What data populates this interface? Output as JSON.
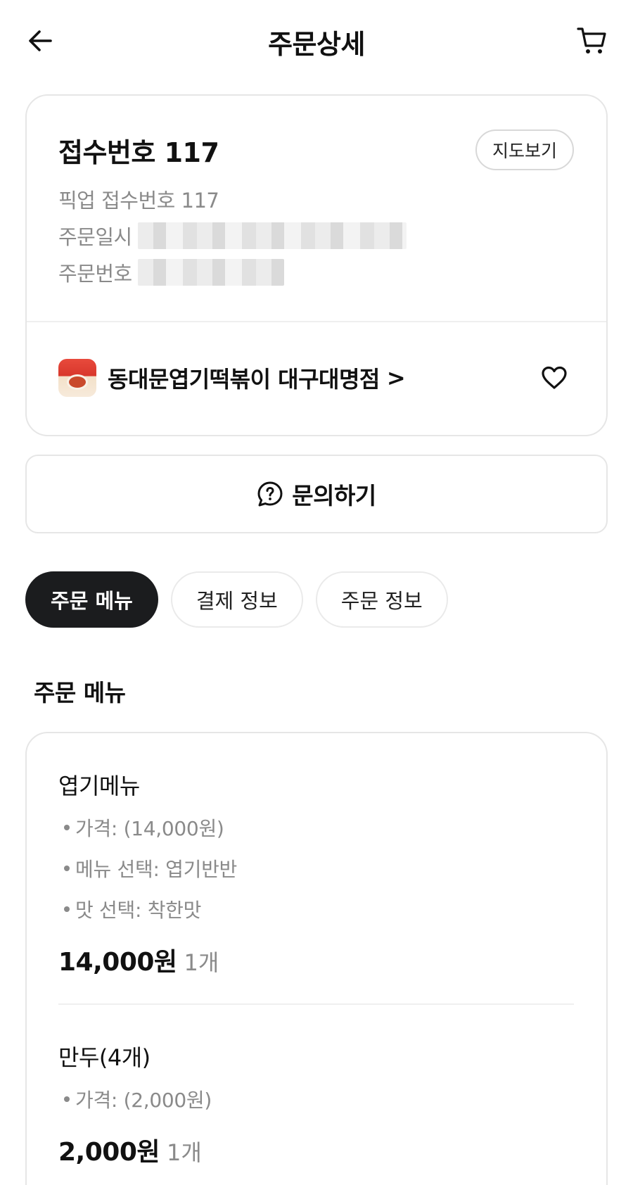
{
  "header": {
    "title": "주문상세",
    "back_icon": "arrow-left-icon",
    "cart_icon": "cart-icon"
  },
  "order": {
    "receipt_title": "접수번호 117",
    "map_button": "지도보기",
    "pickup_label": "픽업 접수번호 117",
    "order_date_label": "주문일시",
    "order_number_label": "주문번호",
    "store_name": "동대문엽기떡볶이 대구대명점",
    "store_chevron": ">"
  },
  "inquiry": {
    "label": "문의하기",
    "icon": "question-bubble-icon"
  },
  "tabs": [
    {
      "label": "주문 메뉴",
      "active": true
    },
    {
      "label": "결제 정보",
      "active": false
    },
    {
      "label": "주문 정보",
      "active": false
    }
  ],
  "section": {
    "title": "주문 메뉴"
  },
  "menu_items": [
    {
      "name": "엽기메뉴",
      "options": [
        "가격:  (14,000원)",
        "메뉴 선택: 엽기반반",
        "맛 선택: 착한맛"
      ],
      "price": "14,000원",
      "qty": "1개"
    },
    {
      "name": "만두(4개)",
      "options": [
        "가격:  (2,000원)"
      ],
      "price": "2,000원",
      "qty": "1개"
    }
  ],
  "colors": {
    "active_tab_bg": "#1b1c1e",
    "muted_text": "#8a8a8a",
    "border": "#e6e6e6"
  }
}
